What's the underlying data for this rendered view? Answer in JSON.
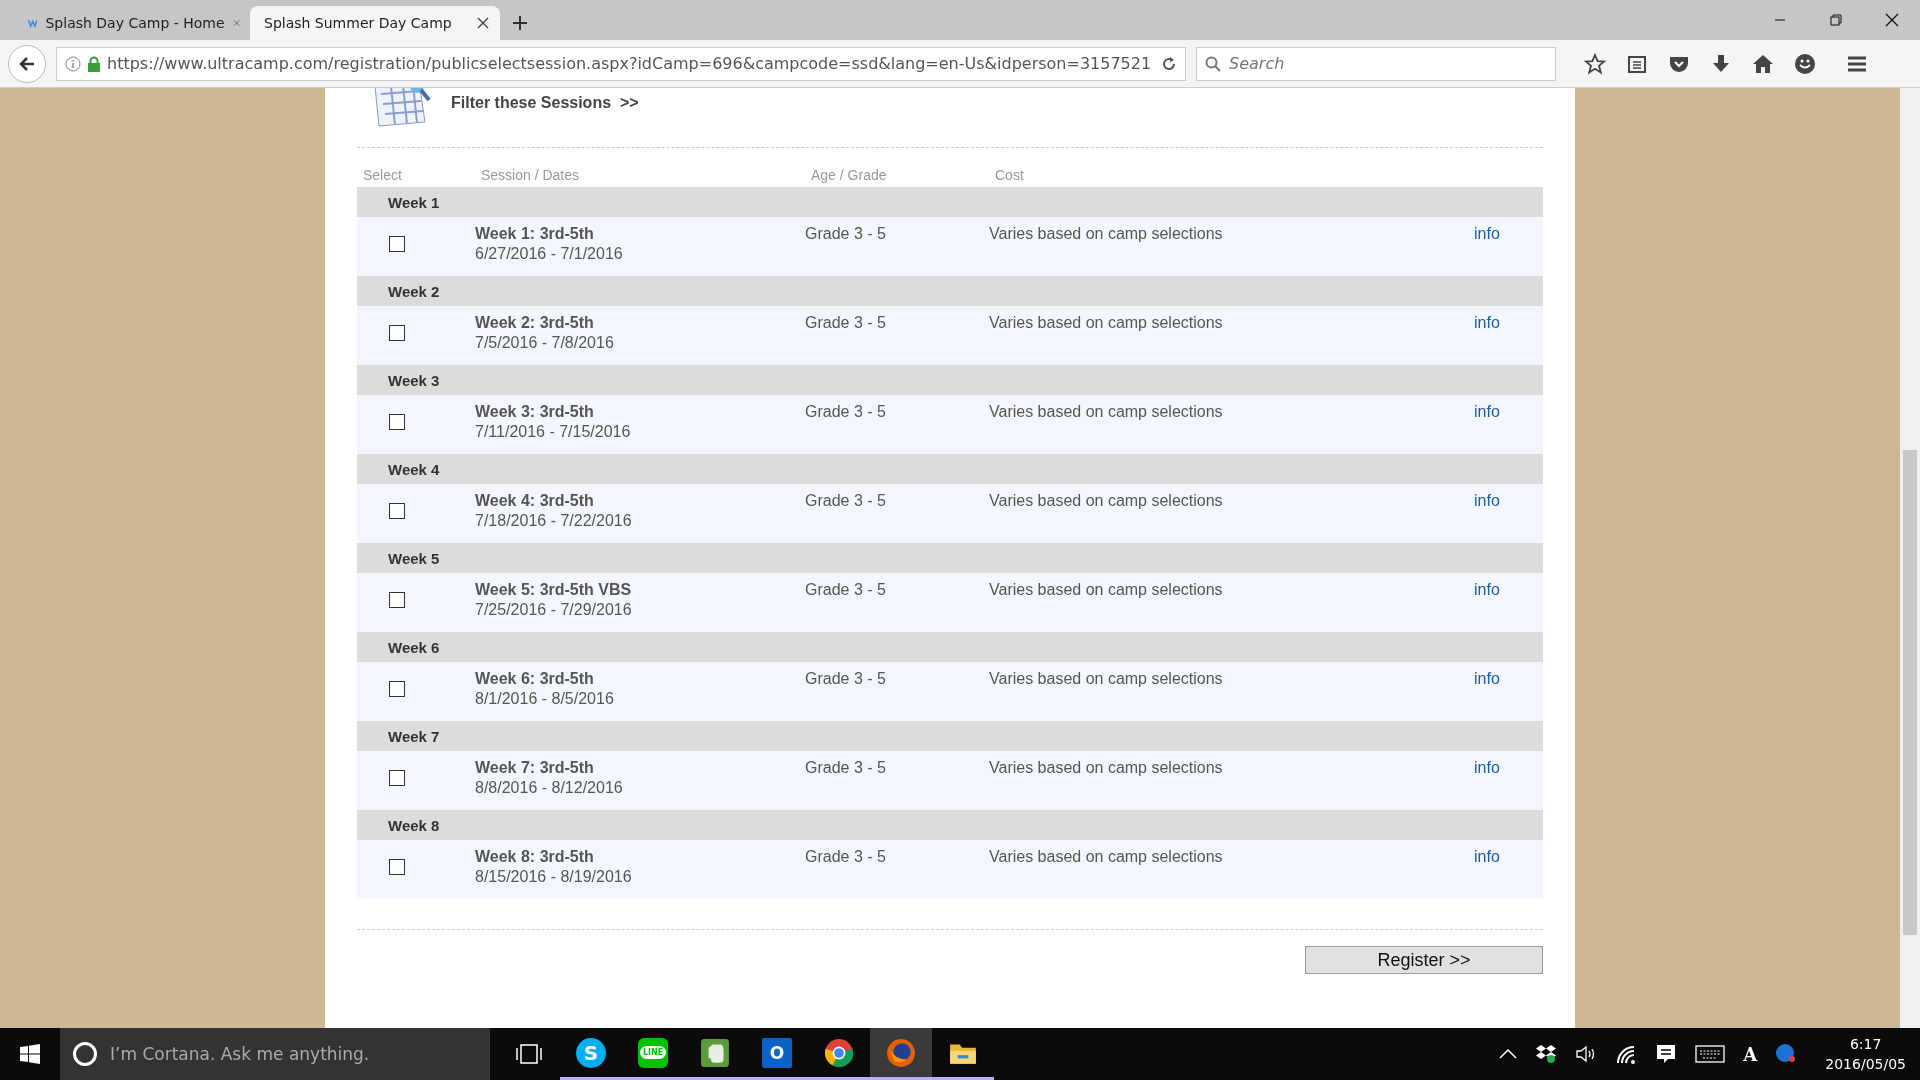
{
  "browser": {
    "tabs": [
      {
        "title": "Splash Day Camp - Home",
        "favicon": true,
        "selected": false
      },
      {
        "title": "Splash Summer Day Camp",
        "favicon": false,
        "selected": true
      }
    ],
    "url": "https://www.ultracamp.com/registration/publicselectsession.aspx?idCamp=696&campcode=ssd&lang=en-Us&idperson=3157521",
    "search": {
      "placeholder": "Search"
    }
  },
  "page": {
    "filter_link": "Filter these Sessions  >>",
    "columns": [
      "Select",
      "Session / Dates",
      "Age / Grade",
      "Cost"
    ],
    "groups": [
      {
        "heading": "Week 1",
        "sessions": [
          {
            "checked": false,
            "title": "Week 1: 3rd-5th",
            "dates": "6/27/2016 - 7/1/2016",
            "grade": "Grade 3 - 5",
            "cost": "Varies based on camp selections",
            "link": "info"
          }
        ]
      },
      {
        "heading": "Week 2",
        "sessions": [
          {
            "checked": false,
            "title": "Week 2: 3rd-5th",
            "dates": "7/5/2016 - 7/8/2016",
            "grade": "Grade 3 - 5",
            "cost": "Varies based on camp selections",
            "link": "info"
          }
        ]
      },
      {
        "heading": "Week 3",
        "sessions": [
          {
            "checked": false,
            "title": "Week 3: 3rd-5th",
            "dates": "7/11/2016 - 7/15/2016",
            "grade": "Grade 3 - 5",
            "cost": "Varies based on camp selections",
            "link": "info"
          }
        ]
      },
      {
        "heading": "Week 4",
        "sessions": [
          {
            "checked": false,
            "title": "Week 4: 3rd-5th",
            "dates": "7/18/2016 - 7/22/2016",
            "grade": "Grade 3 - 5",
            "cost": "Varies based on camp selections",
            "link": "info"
          }
        ]
      },
      {
        "heading": "Week 5",
        "sessions": [
          {
            "checked": false,
            "title": "Week 5: 3rd-5th VBS",
            "dates": "7/25/2016 - 7/29/2016",
            "grade": "Grade 3 - 5",
            "cost": "Varies based on camp selections",
            "link": "info"
          }
        ]
      },
      {
        "heading": "Week 6",
        "sessions": [
          {
            "checked": false,
            "title": "Week 6: 3rd-5th",
            "dates": "8/1/2016 - 8/5/2016",
            "grade": "Grade 3 - 5",
            "cost": "Varies based on camp selections",
            "link": "info"
          }
        ]
      },
      {
        "heading": "Week 7",
        "sessions": [
          {
            "checked": false,
            "title": "Week 7: 3rd-5th",
            "dates": "8/8/2016 - 8/12/2016",
            "grade": "Grade 3 - 5",
            "cost": "Varies based on camp selections",
            "link": "info"
          }
        ]
      },
      {
        "heading": "Week 8",
        "sessions": [
          {
            "checked": false,
            "title": "Week 8: 3rd-5th",
            "dates": "8/15/2016 - 8/19/2016",
            "grade": "Grade 3 - 5",
            "cost": "Varies based on camp selections",
            "link": "info"
          }
        ]
      }
    ],
    "register_button": "Register >>"
  },
  "taskbar": {
    "search": {
      "placeholder": "I’m Cortana. Ask me anything."
    },
    "apps": [
      {
        "kind": "skype",
        "label": "S",
        "active": false
      },
      {
        "kind": "line",
        "label": "LINE",
        "active": false
      },
      {
        "kind": "evernote",
        "active": false
      },
      {
        "kind": "outlook",
        "label": "O",
        "active": false
      },
      {
        "kind": "chrome",
        "active": false
      },
      {
        "kind": "firefox",
        "active": true
      },
      {
        "kind": "explorer",
        "active": false
      }
    ],
    "ime": "A",
    "time": "6:17",
    "date": "2016/05/05"
  }
}
